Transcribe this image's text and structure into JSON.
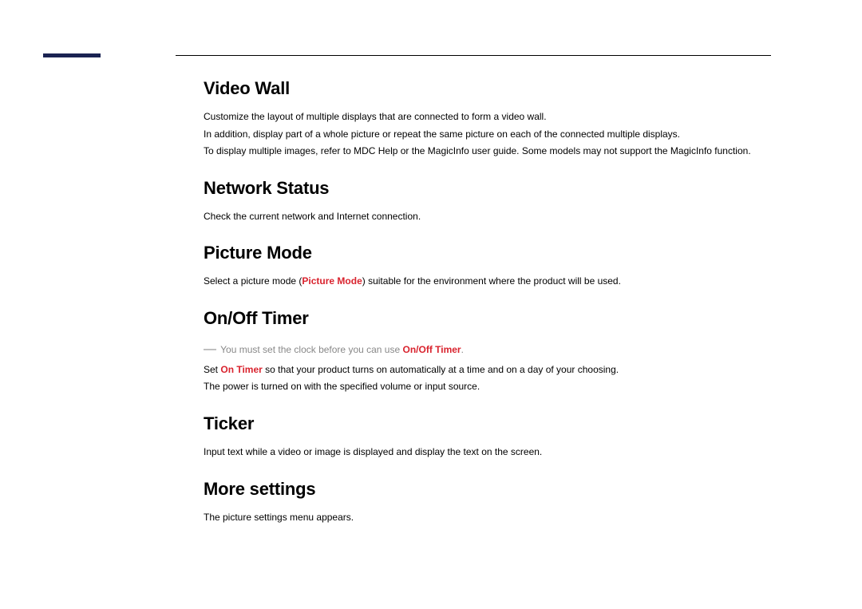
{
  "sections": {
    "videoWall": {
      "heading": "Video Wall",
      "p1": "Customize the layout of multiple displays that are connected to form a video wall.",
      "p2": "In addition, display part of a whole picture or repeat the same picture on each of the connected multiple displays.",
      "p3": "To display multiple images, refer to MDC Help or the MagicInfo user guide. Some models may not support the MagicInfo function."
    },
    "networkStatus": {
      "heading": "Network Status",
      "p1": "Check the current network and Internet connection."
    },
    "pictureMode": {
      "heading": "Picture Mode",
      "p1_pre": "Select a picture mode (",
      "p1_bold": "Picture Mode",
      "p1_post": ") suitable for the environment where the product will be used."
    },
    "onOffTimer": {
      "heading": "On/Off Timer",
      "note_pre": "You must set the clock before you can use ",
      "note_bold": "On/Off Timer",
      "note_post": ".",
      "p1_pre": "Set ",
      "p1_bold": "On Timer",
      "p1_post": " so that your product turns on automatically at a time and on a day of your choosing.",
      "p2": "The power is turned on with the specified volume or input source."
    },
    "ticker": {
      "heading": "Ticker",
      "p1": "Input text while a video or image is displayed and display the text on the screen."
    },
    "moreSettings": {
      "heading": "More settings",
      "p1": "The picture settings menu appears."
    }
  }
}
